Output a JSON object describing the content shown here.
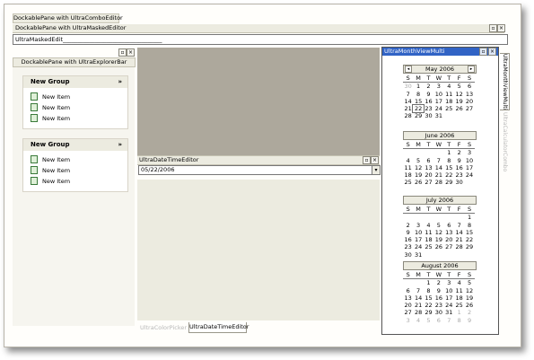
{
  "combo_pane": {
    "tab": "DockablePane with UltraComboEditor"
  },
  "masked_pane": {
    "title": "DockablePane with UltraMaskedEditor",
    "value": "UltraMaskedEdit__________________________________"
  },
  "explorer_pane": {
    "title": "DockablePane with UltraExplorerBar",
    "groups": [
      {
        "title": "New Group",
        "items": [
          "New Item",
          "New Item",
          "New Item"
        ]
      },
      {
        "title": "New Group",
        "items": [
          "New Item",
          "New Item",
          "New Item"
        ]
      }
    ]
  },
  "datetime_pane": {
    "title": "UltraDateTimeEditor",
    "value": "05/22/2006"
  },
  "bottom_tabs": [
    "UltraColorPicker",
    "UltraDateTimeEditor"
  ],
  "month_view": {
    "title": "UltraMonthViewMulti",
    "dow": [
      "S",
      "M",
      "T",
      "W",
      "T",
      "F",
      "S"
    ],
    "months": [
      {
        "name": "May 2006",
        "weeks": [
          [
            "30",
            "1",
            "2",
            "3",
            "4",
            "5",
            "6"
          ],
          [
            "7",
            "8",
            "9",
            "10",
            "11",
            "12",
            "13"
          ],
          [
            "14",
            "15",
            "16",
            "17",
            "18",
            "19",
            "20"
          ],
          [
            "21",
            "22",
            "23",
            "24",
            "25",
            "26",
            "27"
          ],
          [
            "28",
            "29",
            "30",
            "31",
            "",
            "",
            ""
          ]
        ]
      },
      {
        "name": "June 2006",
        "weeks": [
          [
            "",
            "",
            "",
            "",
            "1",
            "2",
            "3"
          ],
          [
            "4",
            "5",
            "6",
            "7",
            "8",
            "9",
            "10"
          ],
          [
            "11",
            "12",
            "13",
            "14",
            "15",
            "16",
            "17"
          ],
          [
            "18",
            "19",
            "20",
            "21",
            "22",
            "23",
            "24"
          ],
          [
            "25",
            "26",
            "27",
            "28",
            "29",
            "30",
            ""
          ]
        ]
      },
      {
        "name": "July 2006",
        "weeks": [
          [
            "",
            "",
            "",
            "",
            "",
            "",
            "1"
          ],
          [
            "2",
            "3",
            "4",
            "5",
            "6",
            "7",
            "8"
          ],
          [
            "9",
            "10",
            "11",
            "12",
            "13",
            "14",
            "15"
          ],
          [
            "16",
            "17",
            "18",
            "19",
            "20",
            "21",
            "22"
          ],
          [
            "23",
            "24",
            "25",
            "26",
            "27",
            "28",
            "29"
          ],
          [
            "30",
            "31",
            "",
            "",
            "",
            "",
            ""
          ]
        ]
      },
      {
        "name": "August 2006",
        "weeks": [
          [
            "",
            "",
            "1",
            "2",
            "3",
            "4",
            "5"
          ],
          [
            "6",
            "7",
            "8",
            "9",
            "10",
            "11",
            "12"
          ],
          [
            "13",
            "14",
            "15",
            "16",
            "17",
            "18",
            "19"
          ],
          [
            "20",
            "21",
            "22",
            "23",
            "24",
            "25",
            "26"
          ],
          [
            "27",
            "28",
            "29",
            "30",
            "31",
            "1",
            "2"
          ],
          [
            "3",
            "4",
            "5",
            "6",
            "7",
            "8",
            "9"
          ]
        ]
      }
    ]
  },
  "side_tabs": [
    "UltraMonthViewMulti",
    "UltraCalculatorCombo"
  ]
}
